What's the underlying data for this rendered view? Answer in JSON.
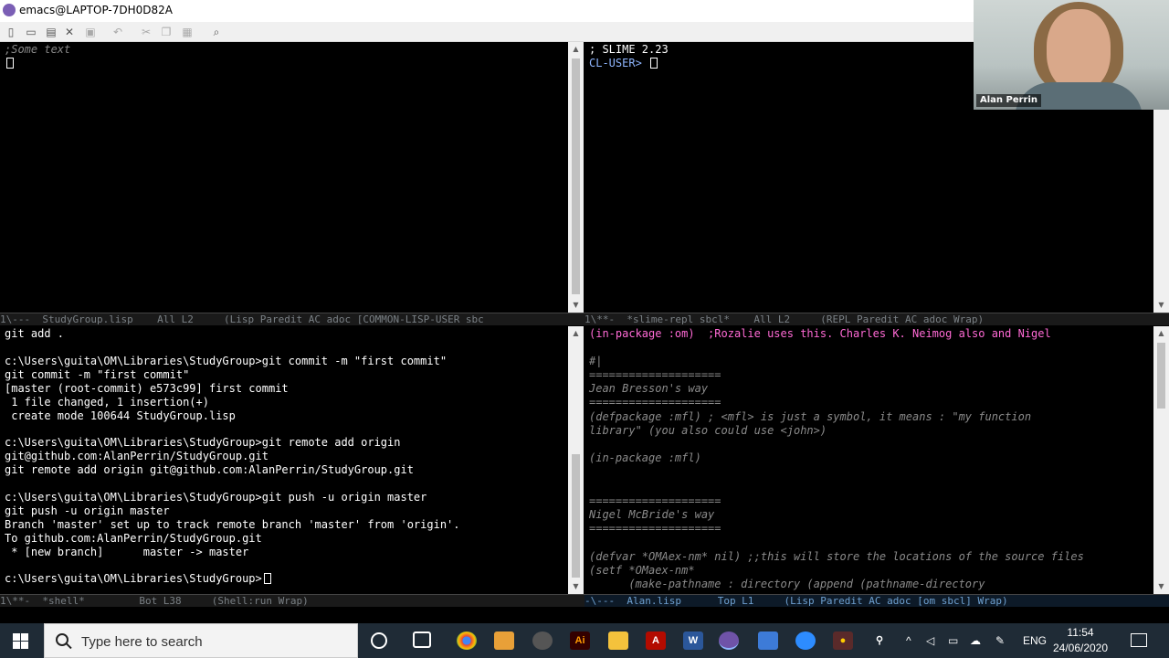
{
  "window": {
    "title": "emacs@LAPTOP-7DH0D82A"
  },
  "toolbar": {
    "buttons": [
      "new-file",
      "open-file",
      "open-dir",
      "close",
      "save",
      "undo",
      "cut",
      "copy",
      "paste",
      "search"
    ]
  },
  "top_left": {
    "lines": [
      ";Some text"
    ]
  },
  "top_right": {
    "lines": [
      "; SLIME 2.23",
      "CL-USER> "
    ]
  },
  "modelines": {
    "top_left": "1\\---  StudyGroup.lisp    All L2     (Lisp Paredit AC adoc [COMMON-LISP-USER sbc",
    "top_right": "1\\**-  *slime-repl sbcl*    All L2     (REPL Paredit AC adoc Wrap)",
    "bottom_left": "1\\**-  *shell*         Bot L38     (Shell:run Wrap)",
    "bottom_right": "-\\---  Alan.lisp      Top L1     (Lisp Paredit AC adoc [om sbcl] Wrap)"
  },
  "shell": {
    "lines": [
      "git add .",
      "",
      "c:\\Users\\guita\\OM\\Libraries\\StudyGroup>git commit -m \"first commit\"",
      "git commit -m \"first commit\"",
      "[master (root-commit) e573c99] first commit",
      " 1 file changed, 1 insertion(+)",
      " create mode 100644 StudyGroup.lisp",
      "",
      "c:\\Users\\guita\\OM\\Libraries\\StudyGroup>git remote add origin",
      "git@github.com:AlanPerrin/StudyGroup.git",
      "git remote add origin git@github.com:AlanPerrin/StudyGroup.git",
      "",
      "c:\\Users\\guita\\OM\\Libraries\\StudyGroup>git push -u origin master",
      "git push -u origin master",
      "Branch 'master' set up to track remote branch 'master' from 'origin'.",
      "To github.com:AlanPerrin/StudyGroup.git",
      " * [new branch]      master -> master",
      "",
      "c:\\Users\\guita\\OM\\Libraries\\StudyGroup>"
    ]
  },
  "alan_lisp": {
    "lines": [
      "(in-package :om)  ;Rozalie uses this. Charles K. Neimog also and Nigel",
      "",
      "#|",
      "====================",
      "Jean Bresson's way",
      "====================",
      "(defpackage :mfl) ; <mfl> is just a symbol, it means : \"my function",
      "library\" (you also could use <john>)",
      "",
      "(in-package :mfl)",
      "",
      "",
      "",
      "====================",
      "Nigel McBride's way",
      "====================",
      "",
      "(defvar *OMAex-nm* nil) ;;this will store the locations of the source files",
      "(setf *OMaex-nm*",
      "      (make-pathname : directory (append (pathname-directory"
    ]
  },
  "webcam": {
    "name": "Alan Perrin"
  },
  "taskbar": {
    "search_placeholder": "Type here to search",
    "language": "ENG",
    "time": "11:54",
    "date": "24/06/2020"
  }
}
